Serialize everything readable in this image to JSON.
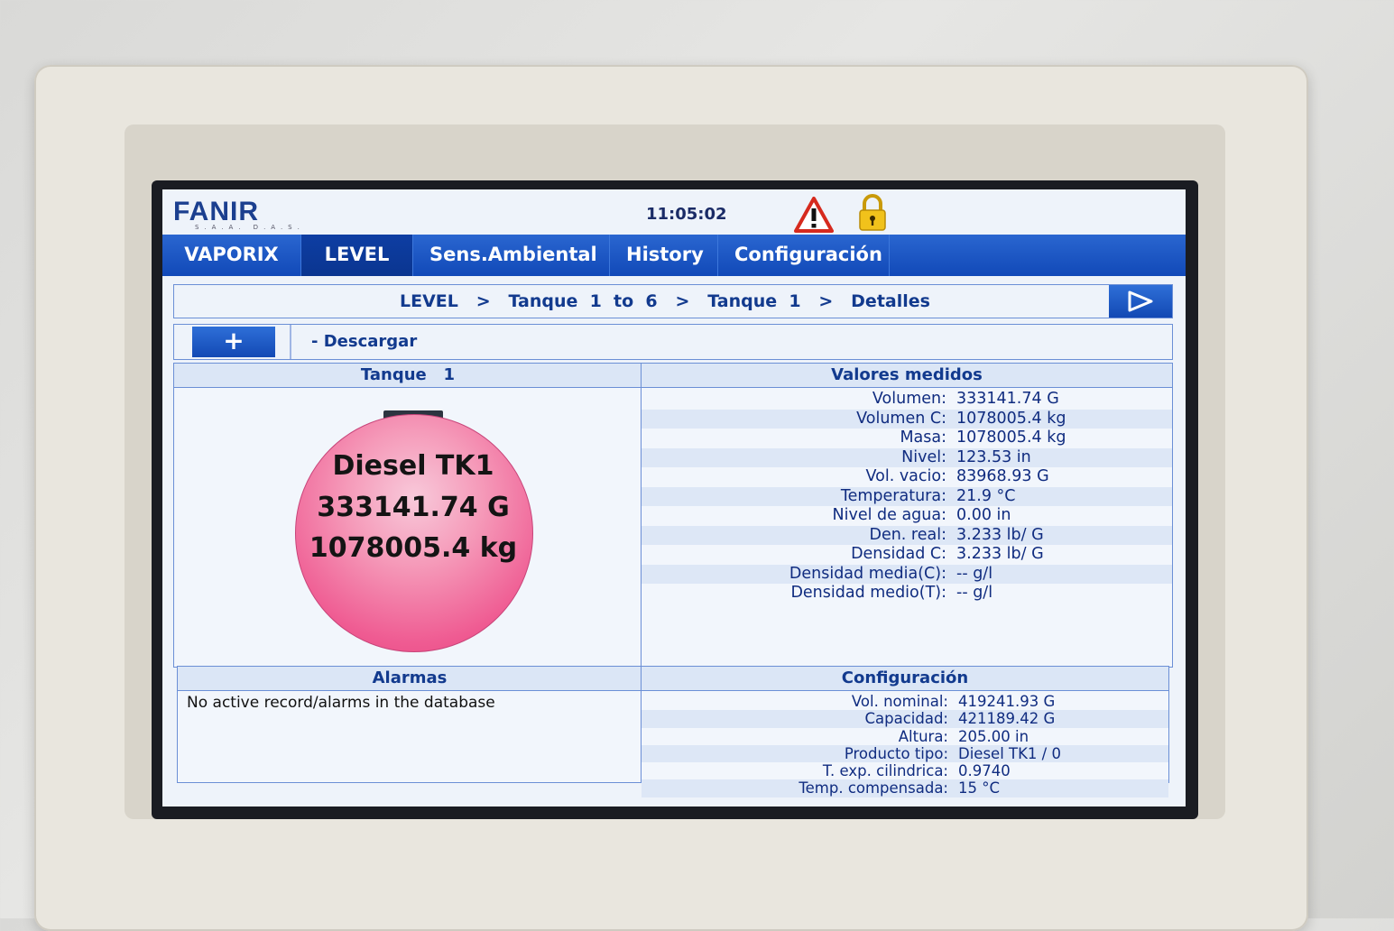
{
  "header": {
    "logo": "FANIR",
    "logo_sub": "S.A.A.      D.A.S.",
    "clock": "11:05:02",
    "icons": [
      "warning-icon",
      "lock-icon"
    ]
  },
  "nav": {
    "tabs": [
      {
        "label": "VAPORIX",
        "active": false
      },
      {
        "label": "LEVEL",
        "active": true
      },
      {
        "label": "Sens.Ambiental",
        "active": false
      },
      {
        "label": "History",
        "active": false
      },
      {
        "label": "Configuración",
        "active": false
      }
    ]
  },
  "breadcrumb": {
    "text": "LEVEL   >   Tanque  1  to  6   >   Tanque  1   >   Detalles"
  },
  "actions": {
    "plus_label": "+",
    "descargar_label": "-  Descargar"
  },
  "tank": {
    "heading": "Tanque   1",
    "name": "Diesel TK1",
    "volume": "333141.74 G",
    "mass": "1078005.4 kg",
    "fill_color": "#ef5b92"
  },
  "measured": {
    "heading": "Valores medidos",
    "rows": [
      {
        "label": "Volumen:",
        "value": "333141.74 G"
      },
      {
        "label": "Volumen C:",
        "value": "1078005.4 kg"
      },
      {
        "label": "Masa:",
        "value": "1078005.4 kg"
      },
      {
        "label": "Nivel:",
        "value": "123.53 in"
      },
      {
        "label": "Vol. vacio:",
        "value": "83968.93 G"
      },
      {
        "label": "Temperatura:",
        "value": "21.9 °C"
      },
      {
        "label": "Nivel de agua:",
        "value": "0.00 in"
      },
      {
        "label": "Den. real:",
        "value": "3.233 lb/ G"
      },
      {
        "label": "Densidad C:",
        "value": "3.233 lb/ G"
      },
      {
        "label": "Densidad media(C):",
        "value": "-- g/l"
      },
      {
        "label": "Densidad medio(T):",
        "value": "-- g/l"
      }
    ]
  },
  "alarms": {
    "heading": "Alarmas",
    "message": "No active record/alarms in the database"
  },
  "config": {
    "heading": "Configuración",
    "rows": [
      {
        "label": "Vol. nominal:",
        "value": "419241.93 G"
      },
      {
        "label": "Capacidad:",
        "value": "421189.42 G"
      },
      {
        "label": "Altura:",
        "value": "205.00 in"
      },
      {
        "label": "Producto tipo:",
        "value": "Diesel TK1 / 0"
      },
      {
        "label": "T. exp. cilindrica:",
        "value": "0.9740"
      },
      {
        "label": "Temp. compensada:",
        "value": "15 °C"
      }
    ]
  },
  "colors": {
    "nav_blue": "#1149b8",
    "text_blue": "#123a8e",
    "warning_red": "#d62a1e",
    "lock_yellow": "#f1c21b"
  }
}
